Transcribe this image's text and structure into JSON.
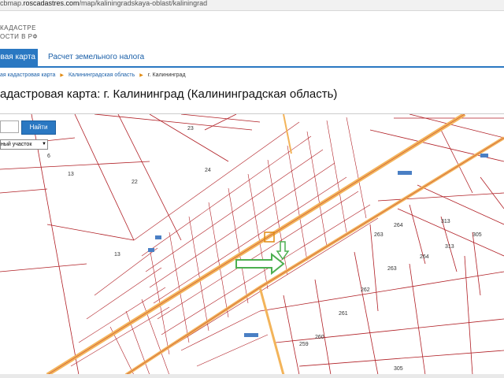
{
  "browser": {
    "url_prefix": "cbmap.",
    "url_host": "roscadastres.com",
    "url_path": "/map/kaliningradskaya-oblast/kaliningrad"
  },
  "header": {
    "logo_line1": "КАДАСТРЕ",
    "logo_line2": "ОСТИ В РФ"
  },
  "nav": {
    "active_tab": "ровая карта",
    "tax_link": "Расчет земельного налога"
  },
  "breadcrumbs": {
    "item1": "ая кадастровая карта",
    "item2": "Калининградская область",
    "item3": "г. Калининград"
  },
  "page": {
    "title": "адастровая карта: г. Калининград (Калининградская область)"
  },
  "search": {
    "value": "",
    "button_label": "Найти",
    "type_selected": "ный участок"
  },
  "map": {
    "line_color": "#b01e24",
    "road_color": "#f3b45a",
    "arrow_color": "#4caf50",
    "marker_color": "#e08a10",
    "parcel_labels": [
      "23",
      "24",
      "22",
      "13",
      "6",
      "13",
      "263",
      "264",
      "313",
      "305",
      "262",
      "261",
      "260",
      "259",
      "305",
      "313",
      "263",
      "264"
    ],
    "road_signs": [
      "",
      "",
      "",
      "",
      ""
    ]
  }
}
